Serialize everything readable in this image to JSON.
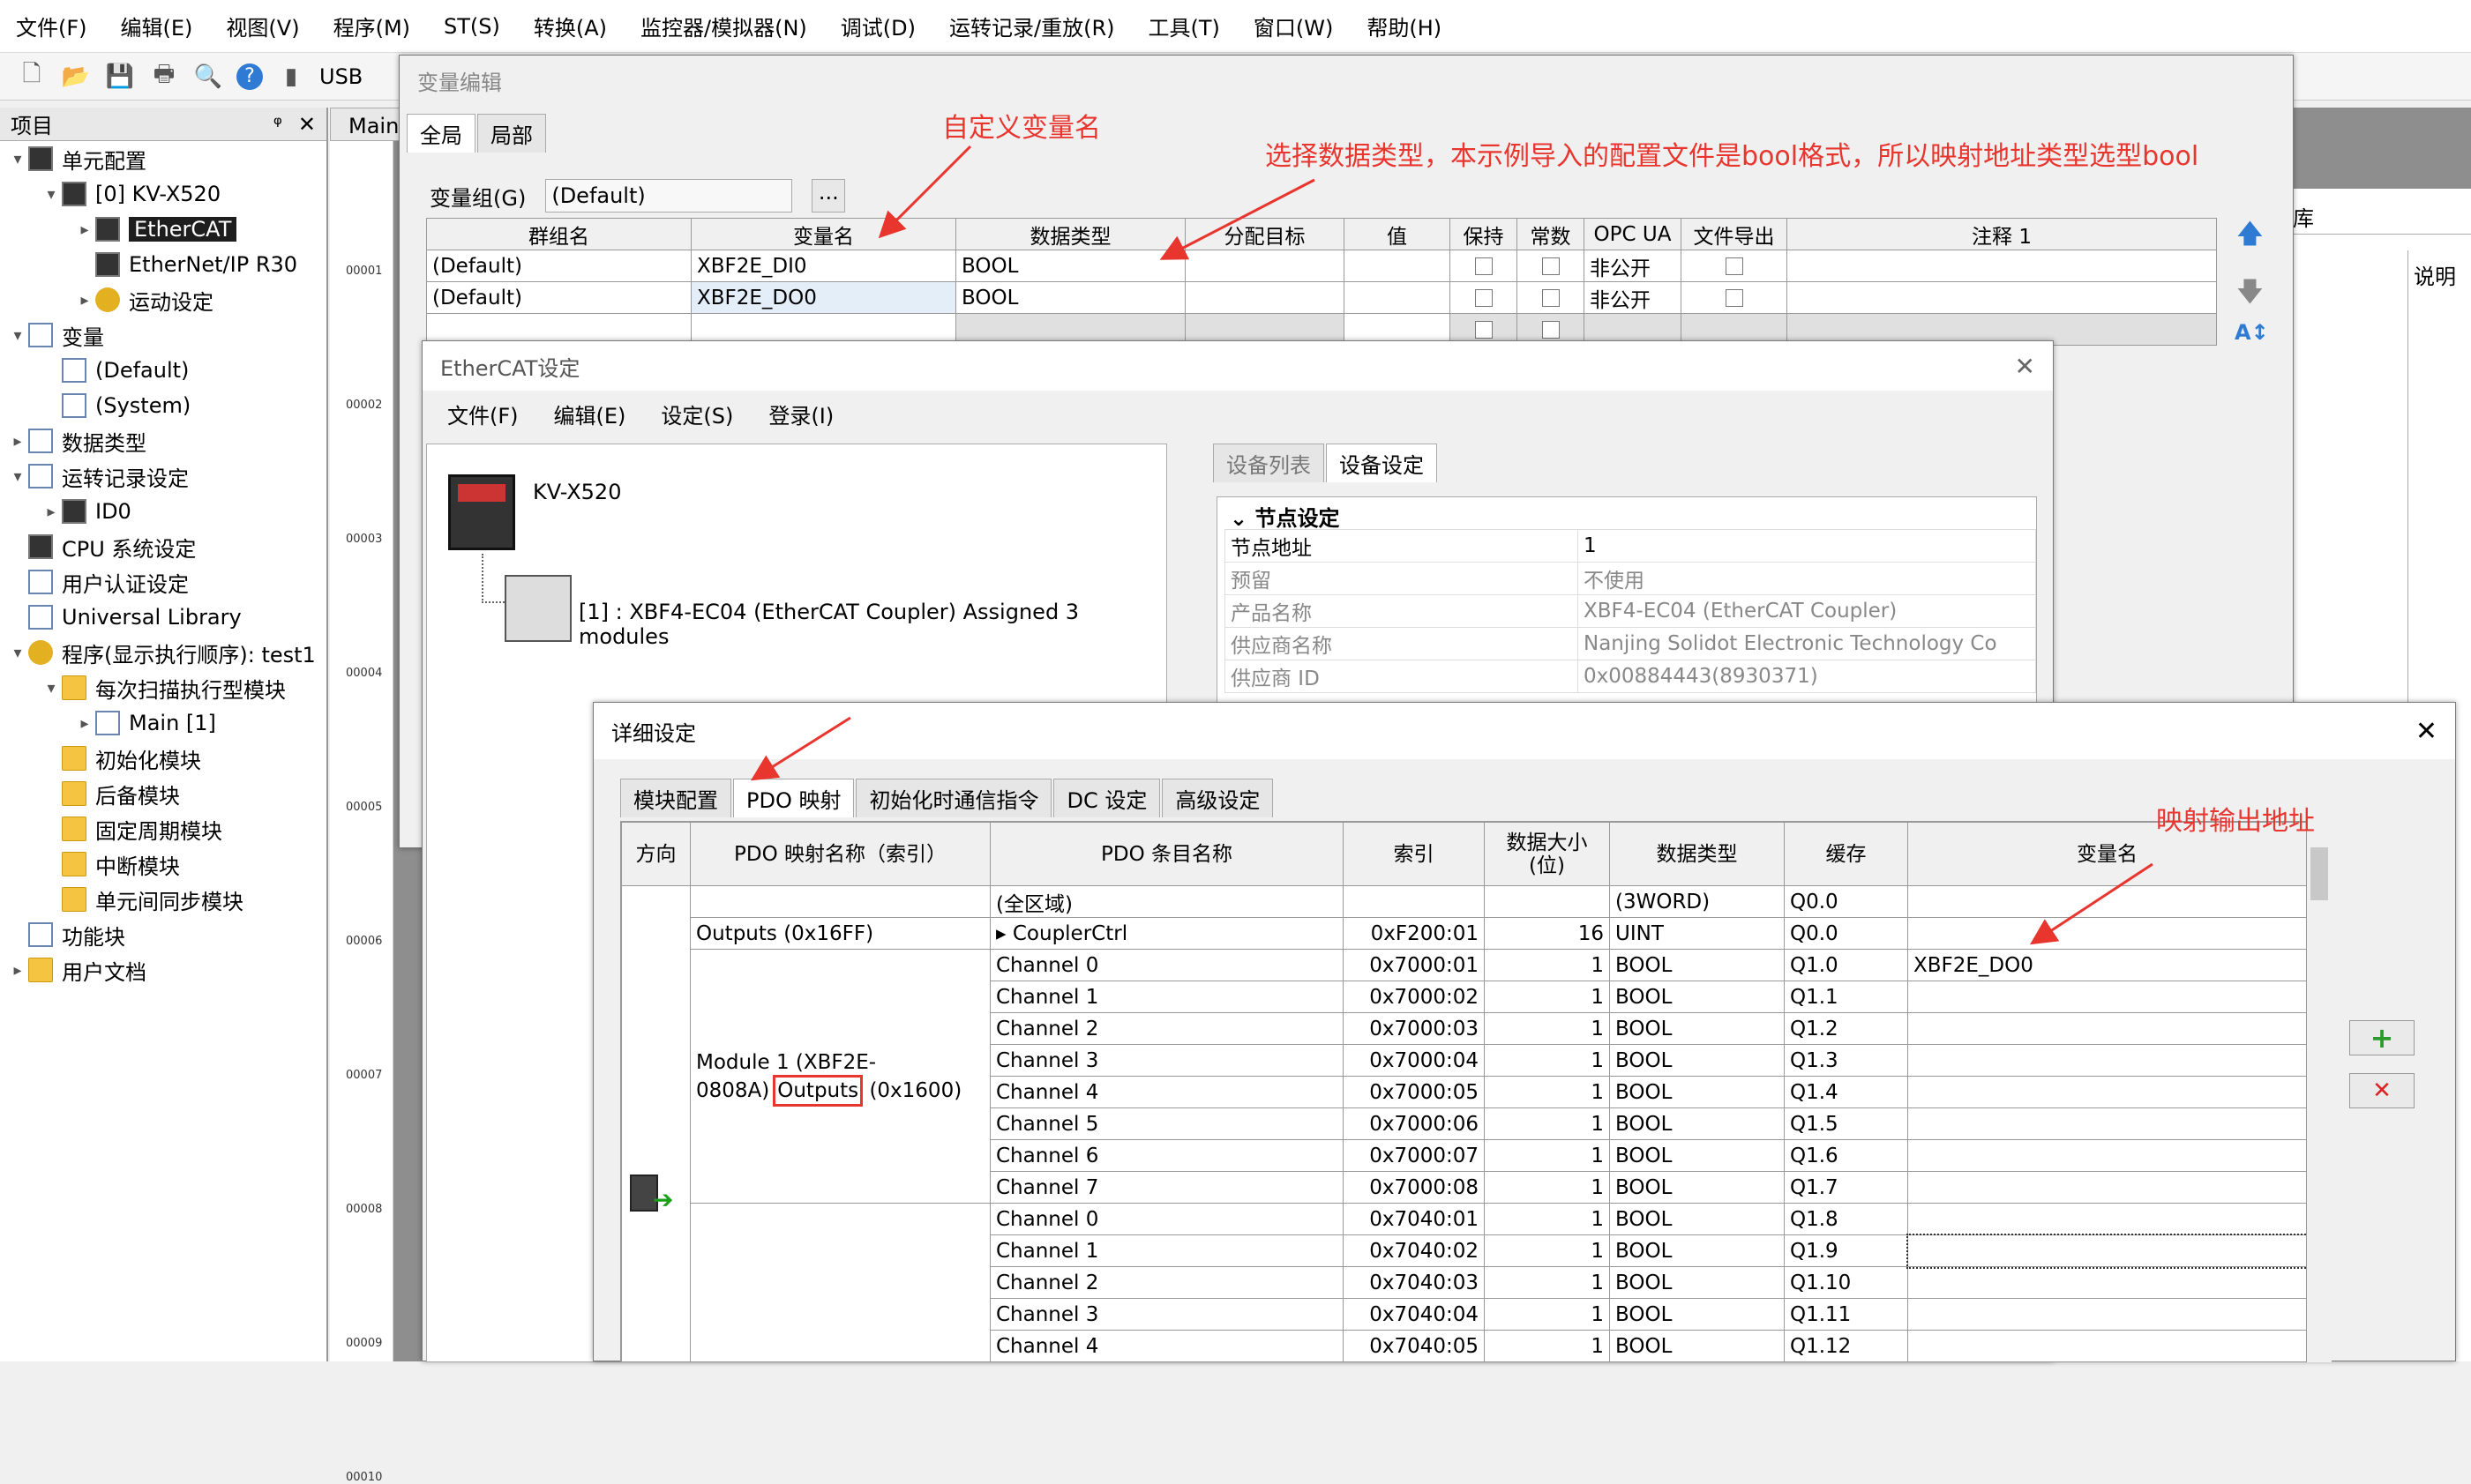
{
  "menu": [
    "文件(F)",
    "编辑(E)",
    "视图(V)",
    "程序(M)",
    "ST(S)",
    "转换(A)",
    "监控器/模拟器(N)",
    "调试(D)",
    "运转记录/重放(R)",
    "工具(T)",
    "窗口(W)",
    "帮助(H)"
  ],
  "toolbar": {
    "usb_label": "USB"
  },
  "project": {
    "title": "项目",
    "pin": "ᵠ",
    "close": "✕",
    "tree": [
      {
        "label": "单元配置",
        "indent": 0,
        "arrow": "▾",
        "icon": "cpu"
      },
      {
        "label": "[0]  KV-X520",
        "indent": 1,
        "arrow": "▾",
        "icon": "cpu"
      },
      {
        "label": "EtherCAT",
        "indent": 2,
        "arrow": "▸",
        "icon": "cpu",
        "selected": true
      },
      {
        "label": "EtherNet/IP   R30",
        "indent": 2,
        "arrow": "",
        "icon": "cpu"
      },
      {
        "label": "运动设定",
        "indent": 2,
        "arrow": "▸",
        "icon": "gear"
      },
      {
        "label": "变量",
        "indent": 0,
        "arrow": "▾",
        "icon": "doc"
      },
      {
        "label": "(Default)",
        "indent": 1,
        "arrow": "",
        "icon": "doc"
      },
      {
        "label": "(System)",
        "indent": 1,
        "arrow": "",
        "icon": "doc"
      },
      {
        "label": "数据类型",
        "indent": 0,
        "arrow": "▸",
        "icon": "doc"
      },
      {
        "label": "运转记录设定",
        "indent": 0,
        "arrow": "▾",
        "icon": "doc"
      },
      {
        "label": "ID0",
        "indent": 1,
        "arrow": "▸",
        "icon": "cpu"
      },
      {
        "label": "CPU 系统设定",
        "indent": 0,
        "arrow": "",
        "icon": "cpu"
      },
      {
        "label": "用户认证设定",
        "indent": 0,
        "arrow": "",
        "icon": "doc"
      },
      {
        "label": "Universal Library",
        "indent": 0,
        "arrow": "",
        "icon": "doc"
      },
      {
        "label": "程序(显示执行顺序): test1",
        "indent": 0,
        "arrow": "▾",
        "icon": "gear"
      },
      {
        "label": "每次扫描执行型模块",
        "indent": 1,
        "arrow": "▾",
        "icon": "fold"
      },
      {
        "label": "Main [1]",
        "indent": 2,
        "arrow": "▸",
        "icon": "doc"
      },
      {
        "label": "初始化模块",
        "indent": 1,
        "arrow": "",
        "icon": "fold"
      },
      {
        "label": "后备模块",
        "indent": 1,
        "arrow": "",
        "icon": "fold"
      },
      {
        "label": "固定周期模块",
        "indent": 1,
        "arrow": "",
        "icon": "fold"
      },
      {
        "label": "中断模块",
        "indent": 1,
        "arrow": "",
        "icon": "fold"
      },
      {
        "label": "单元间同步模块",
        "indent": 1,
        "arrow": "",
        "icon": "fold"
      },
      {
        "label": "功能块",
        "indent": 0,
        "arrow": "",
        "icon": "doc"
      },
      {
        "label": "用户文档",
        "indent": 0,
        "arrow": "▸",
        "icon": "fold"
      }
    ]
  },
  "editor": {
    "tab": "Main",
    "lines": [
      "00001",
      "00002",
      "00003",
      "00004",
      "00005",
      "00006",
      "00007",
      "00008",
      "00009",
      "00010"
    ],
    "right_header": "库",
    "right_col": "说明"
  },
  "var_editor": {
    "title": "变量编辑",
    "tabs": [
      "全局",
      "局部"
    ],
    "group_label": "变量组(G)",
    "group_value": "(Default)",
    "browse": "...",
    "headers": [
      "群组名",
      "变量名",
      "数据类型",
      "分配目标",
      "值",
      "保持",
      "常数",
      "OPC UA",
      "文件导出",
      "注释 1"
    ],
    "rows": [
      [
        "(Default)",
        "XBF2E_DI0",
        "BOOL",
        "非公开"
      ],
      [
        "(Default)",
        "XBF2E_DO0",
        "BOOL",
        "非公开"
      ]
    ]
  },
  "ethercat": {
    "title": "EtherCAT设定",
    "menu": [
      "文件(F)",
      "编辑(E)",
      "设定(S)",
      "登录(I)"
    ],
    "cpu": "KV-X520",
    "coupler": "[1] : XBF4-EC04 (EtherCAT Coupler) Assigned 3 modules",
    "tabs": [
      "设备列表",
      "设备设定"
    ],
    "section": "节点设定",
    "props": [
      [
        "节点地址",
        "1"
      ],
      [
        "预留",
        "不使用"
      ],
      [
        "产品名称",
        "XBF4-EC04 (EtherCAT Coupler)"
      ],
      [
        "供应商名称",
        "Nanjing Solidot Electronic Technology Co"
      ],
      [
        "供应商 ID",
        "0x00884443(8930371)"
      ]
    ]
  },
  "detail": {
    "title": "详细设定",
    "tabs": [
      "模块配置",
      "PDO 映射",
      "初始化时通信指令",
      "DC 设定",
      "高级设定"
    ],
    "headers": [
      "方向",
      "PDO 映射名称（索引）",
      "PDO 条目名称",
      "索引",
      "数据大小\n(位)",
      "数据类型",
      "缓存",
      "变量名"
    ],
    "area_row": {
      "entry": "(全区域)",
      "type": "(3WORD)",
      "buf": "Q0.0"
    },
    "outputs_row": {
      "name": "Outputs (0x16FF)",
      "entry": "CouplerCtrl",
      "index": "0xF200:01",
      "size": "16",
      "type": "UINT",
      "buf": "Q0.0"
    },
    "module1_name_a": "Module 1 (XBF2E-",
    "module1_name_b": "0808A)",
    "module1_hl": "Outputs",
    "module1_name_c": " (0x1600)",
    "rows": [
      {
        "entry": "Channel 0",
        "index": "0x7000:01",
        "size": "1",
        "type": "BOOL",
        "buf": "Q1.0",
        "var": "XBF2E_DO0"
      },
      {
        "entry": "Channel 1",
        "index": "0x7000:02",
        "size": "1",
        "type": "BOOL",
        "buf": "Q1.1",
        "var": ""
      },
      {
        "entry": "Channel 2",
        "index": "0x7000:03",
        "size": "1",
        "type": "BOOL",
        "buf": "Q1.2",
        "var": ""
      },
      {
        "entry": "Channel 3",
        "index": "0x7000:04",
        "size": "1",
        "type": "BOOL",
        "buf": "Q1.3",
        "var": ""
      },
      {
        "entry": "Channel 4",
        "index": "0x7000:05",
        "size": "1",
        "type": "BOOL",
        "buf": "Q1.4",
        "var": ""
      },
      {
        "entry": "Channel 5",
        "index": "0x7000:06",
        "size": "1",
        "type": "BOOL",
        "buf": "Q1.5",
        "var": ""
      },
      {
        "entry": "Channel 6",
        "index": "0x7000:07",
        "size": "1",
        "type": "BOOL",
        "buf": "Q1.6",
        "var": ""
      },
      {
        "entry": "Channel 7",
        "index": "0x7000:08",
        "size": "1",
        "type": "BOOL",
        "buf": "Q1.7",
        "var": ""
      },
      {
        "entry": "Channel 0",
        "index": "0x7040:01",
        "size": "1",
        "type": "BOOL",
        "buf": "Q1.8",
        "var": ""
      },
      {
        "entry": "Channel 1",
        "index": "0x7040:02",
        "size": "1",
        "type": "BOOL",
        "buf": "Q1.9",
        "var": ""
      },
      {
        "entry": "Channel 2",
        "index": "0x7040:03",
        "size": "1",
        "type": "BOOL",
        "buf": "Q1.10",
        "var": ""
      },
      {
        "entry": "Channel 3",
        "index": "0x7040:04",
        "size": "1",
        "type": "BOOL",
        "buf": "Q1.11",
        "var": ""
      },
      {
        "entry": "Channel 4",
        "index": "0x7040:05",
        "size": "1",
        "type": "BOOL",
        "buf": "Q1.12",
        "var": ""
      }
    ],
    "add": "+",
    "remove": "✕"
  },
  "annotations": {
    "custom_var": "自定义变量名",
    "data_type": "选择数据类型，本示例导入的配置文件是bool格式，所以映射地址类型选型bool",
    "output_addr": "映射输出地址"
  },
  "colors": {
    "annotation": "#e8352e",
    "selected": "#1e1e1e"
  }
}
